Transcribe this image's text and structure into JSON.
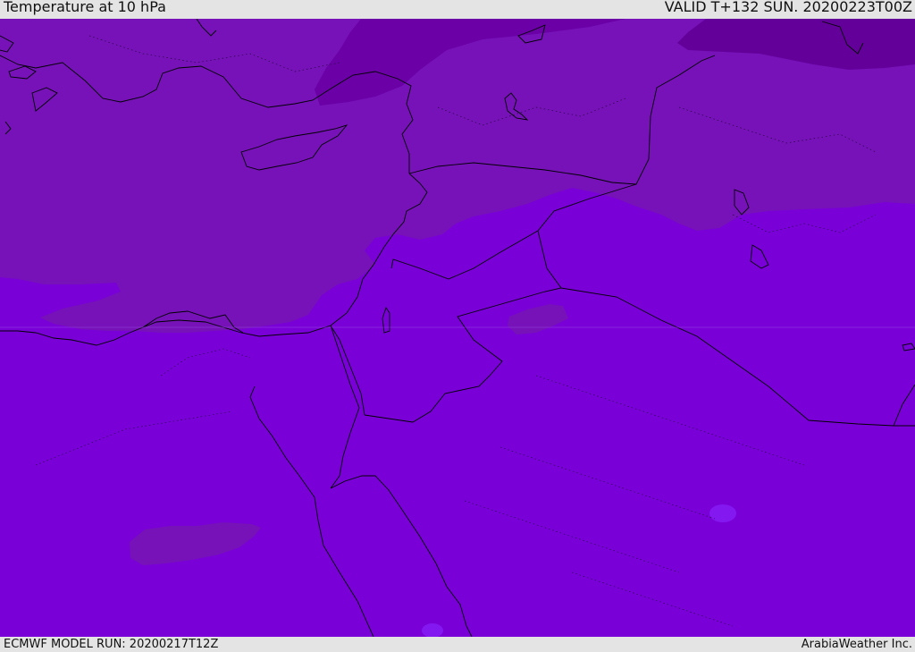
{
  "header": {
    "title": "Temperature at 10 hPa",
    "valid": "VALID T+132 SUN. 20200223T00Z"
  },
  "footer": {
    "model_run": "ECMWF MODEL RUN: 20200217T12Z",
    "credit": "ArabiaWeather Inc."
  },
  "map": {
    "region": "Eastern Mediterranean and Middle East",
    "colors": {
      "background": "#7a00d8",
      "band_mid": "#7612b8",
      "band_cold": "#6a00a6",
      "band_coldest": "#64009a",
      "warm_spot": "#8418f0",
      "outline": "#000000"
    }
  }
}
